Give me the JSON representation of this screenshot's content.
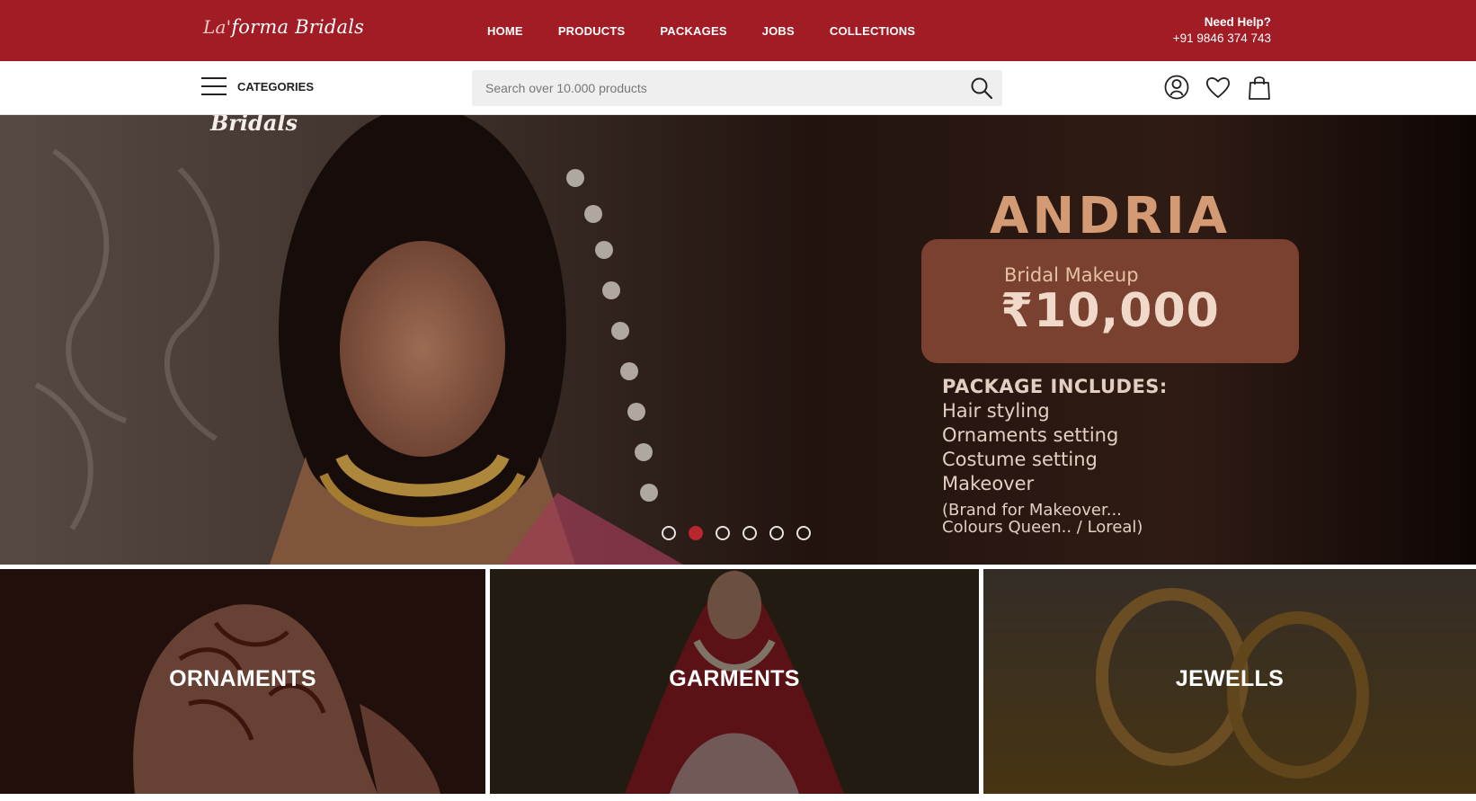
{
  "header": {
    "logo_prefix": "La'",
    "logo_text": "forma Bridals",
    "nav": [
      {
        "label": "HOME"
      },
      {
        "label": "PRODUCTS"
      },
      {
        "label": "PACKAGES"
      },
      {
        "label": "JOBS"
      },
      {
        "label": "COLLECTIONS"
      }
    ],
    "help_title": "Need Help?",
    "help_phone": "+91 9846 374 743",
    "accent_color": "#a11c24"
  },
  "toolbar": {
    "categories_label": "CATEGORIES",
    "search_placeholder": "Search over 10.000 products",
    "icons": [
      "user-icon",
      "heart-icon",
      "bag-icon"
    ]
  },
  "hero": {
    "brand_text": "Bridals",
    "promo_title": "ANDRIA",
    "promo_label": "Bridal Makeup",
    "promo_price": "₹10,000",
    "package_heading": "PACKAGE INCLUDES:",
    "package_items": [
      "Hair styling",
      "Ornaments setting",
      "Costume setting",
      "Makeover"
    ],
    "package_note_1": "(Brand  for Makeover...",
    "package_note_2": " Colours Queen.. / Loreal)",
    "slide_count": 6,
    "active_slide": 2
  },
  "tiles": [
    {
      "label": "ORNAMENTS"
    },
    {
      "label": "GARMENTS"
    },
    {
      "label": "JEWELLS"
    }
  ]
}
